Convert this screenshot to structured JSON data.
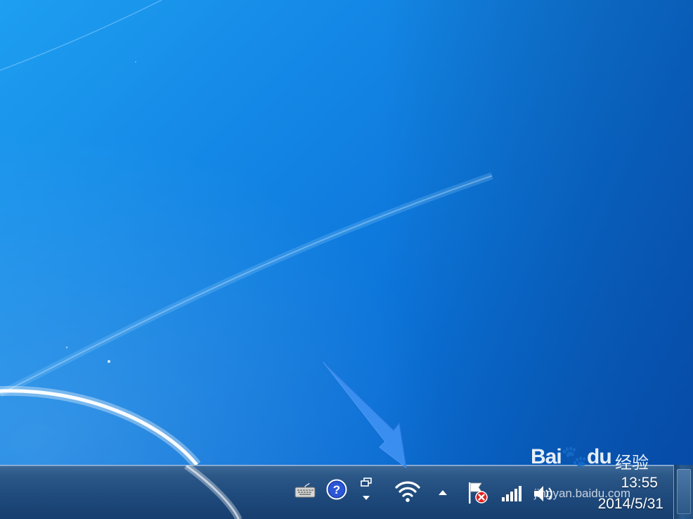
{
  "desktop": {
    "background_color": "#1488e6"
  },
  "taskbar": {
    "tray_icons": [
      {
        "name": "keyboard-icon"
      },
      {
        "name": "help-icon"
      },
      {
        "name": "windows-switcher-icon"
      },
      {
        "name": "wifi-icon"
      },
      {
        "name": "show-hidden-icons-arrow"
      },
      {
        "name": "action-center-flag-icon"
      },
      {
        "name": "signal-bars-icon"
      },
      {
        "name": "volume-icon"
      }
    ],
    "clock": {
      "time": "13:55",
      "date": "2014/5/31"
    }
  },
  "annotation": {
    "arrow_color": "#3a8ef0",
    "points_to": "wifi-icon"
  },
  "watermark": {
    "brand": "Bai🐾du",
    "subtitle": "经验",
    "url": "jingyan.baidu.com"
  }
}
